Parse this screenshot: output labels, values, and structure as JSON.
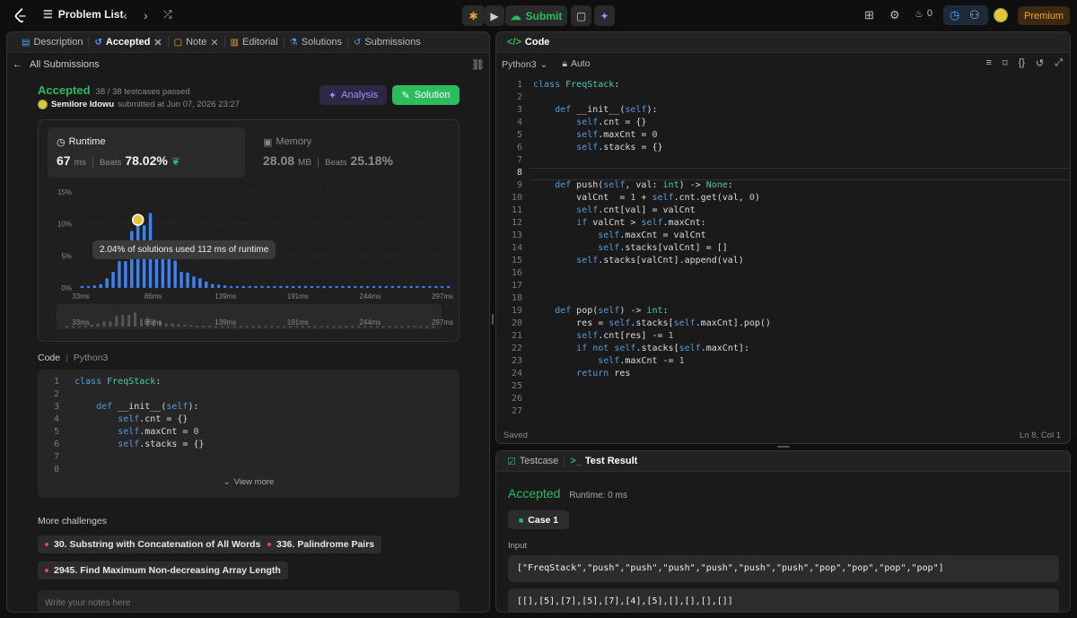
{
  "topbar": {
    "problem_list": "Problem List",
    "submit": "Submit",
    "streak": "0",
    "premium": "Premium"
  },
  "left": {
    "tabs": [
      {
        "label": "Description"
      },
      {
        "label": "Accepted"
      },
      {
        "label": "Note"
      },
      {
        "label": "Editorial"
      },
      {
        "label": "Solutions"
      },
      {
        "label": "Submissions"
      }
    ],
    "all_submissions": "All Submissions",
    "status": "Accepted",
    "testcases": "38 / 38 testcases passed",
    "user": "Semilore Idowu",
    "submitted_at": "submitted at Jun 07, 2026 23:27",
    "analysis_btn": "Analysis",
    "solution_btn": "Solution",
    "runtime": {
      "label": "Runtime",
      "value": "67",
      "unit": "ms",
      "beats_label": "Beats",
      "beats": "78.02%"
    },
    "memory": {
      "label": "Memory",
      "value": "28.08",
      "unit": "MB",
      "beats_label": "Beats",
      "beats": "25.18%"
    },
    "tooltip": "2.04% of solutions used 112 ms of runtime",
    "code_label": "Code",
    "code_lang": "Python3",
    "code_lines": [
      "class FreqStack:",
      "",
      "    def __init__(self):",
      "        self.cnt = {}",
      "        self.maxCnt = 0",
      "        self.stacks = {}",
      "",
      ""
    ],
    "view_more": "View more",
    "more_challenges": "More challenges",
    "challenges": [
      "30. Substring with Concatenation of All Words",
      "336. Palindrome Pairs",
      "2945. Find Maximum Non-decreasing Array Length"
    ],
    "notes_placeholder": "Write your notes here"
  },
  "chart_data": {
    "type": "bar",
    "title": "",
    "ylim": [
      0,
      15
    ],
    "y_ticks": [
      "15%",
      "10%",
      "5%",
      "0%"
    ],
    "x_ticks": [
      "33ms",
      "86ms",
      "139ms",
      "191ms",
      "244ms",
      "297ms"
    ],
    "values": [
      0.3,
      0.3,
      0.4,
      0.6,
      1.5,
      2.5,
      4.2,
      4.2,
      8.9,
      9.8,
      9.8,
      11.7,
      6.3,
      7.4,
      5.9,
      4.3,
      2.5,
      2.4,
      1.8,
      1.5,
      1.0,
      0.6,
      0.5,
      0.4,
      0.3,
      0.3,
      0.3,
      0.3,
      0.3,
      0.3,
      0.3,
      0.3,
      0.3,
      0.3,
      0.3,
      0.3,
      0.3,
      0.3,
      0.3,
      0.3,
      0.3,
      0.3,
      0.3,
      0.3,
      0.3,
      0.3,
      0.3,
      0.3,
      0.3,
      0.3,
      0.3,
      0.3,
      0.3,
      0.3,
      0.3,
      0.3,
      0.3,
      0.3,
      0.3,
      0.3
    ],
    "highlight_index": 9,
    "color": "#3b82f6"
  },
  "editor": {
    "title": "Code",
    "lang": "Python3",
    "mode": "Auto",
    "lines": [
      "class FreqStack:",
      "",
      "    def __init__(self):",
      "        self.cnt = {}",
      "        self.maxCnt = 0",
      "        self.stacks = {}",
      "",
      "",
      "    def push(self, val: int) -> None:",
      "        valCnt  = 1 + self.cnt.get(val, 0)",
      "        self.cnt[val] = valCnt",
      "        if valCnt > self.maxCnt:",
      "            self.maxCnt = valCnt",
      "            self.stacks[valCnt] = []",
      "        self.stacks[valCnt].append(val)",
      "",
      "",
      "",
      "    def pop(self) -> int:",
      "        res = self.stacks[self.maxCnt].pop()",
      "        self.cnt[res] -= 1",
      "        if not self.stacks[self.maxCnt]:",
      "            self.maxCnt -= 1",
      "        return res",
      "",
      "",
      ""
    ],
    "saved": "Saved",
    "cursor": "Ln 8, Col 1"
  },
  "result": {
    "tab_testcase": "Testcase",
    "tab_result": "Test Result",
    "status": "Accepted",
    "runtime": "Runtime: 0 ms",
    "case": "Case 1",
    "input_label": "Input",
    "input1": "[\"FreqStack\",\"push\",\"push\",\"push\",\"push\",\"push\",\"push\",\"pop\",\"pop\",\"pop\",\"pop\"]",
    "input2": "[[],[5],[7],[5],[7],[4],[5],[],[],[],[]]"
  }
}
